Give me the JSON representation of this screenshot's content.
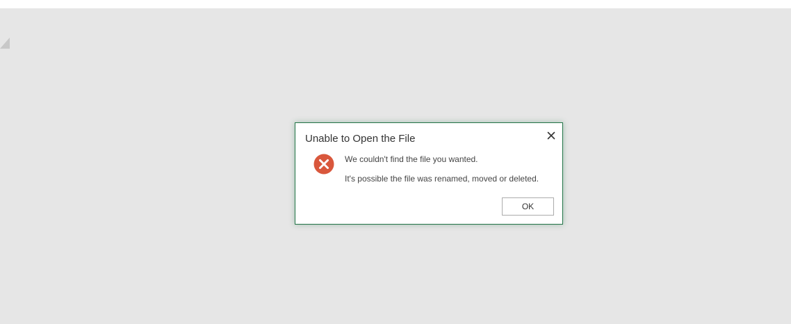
{
  "dialog": {
    "title": "Unable to Open the File",
    "message_primary": "We couldn't find the file you wanted.",
    "message_secondary": "It's possible the file was renamed, moved or deleted.",
    "ok_label": "OK",
    "close_icon": "close-icon",
    "status_icon": "error-icon"
  },
  "colors": {
    "background": "#e6e6e6",
    "dialog_border": "#217346",
    "error_icon": "#d9573c"
  }
}
